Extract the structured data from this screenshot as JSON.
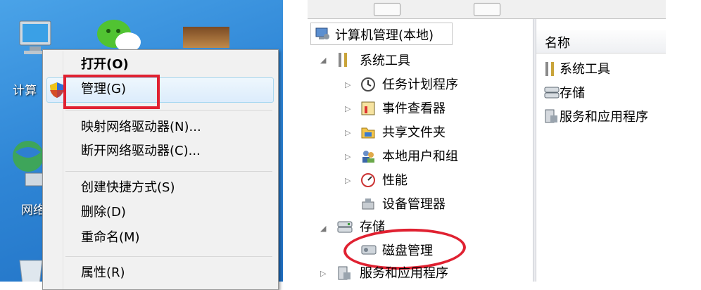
{
  "context_menu": {
    "open": "打开(O)",
    "manage": "管理(G)",
    "map_drive": "映射网络驱动器(N)...",
    "disconnect_drive": "断开网络驱动器(C)...",
    "create_shortcut": "创建快捷方式(S)",
    "delete": "删除(D)",
    "rename": "重命名(M)",
    "properties": "属性(R)"
  },
  "desktop": {
    "computer_label": "计算",
    "network_label": "网络"
  },
  "tree": {
    "root": "计算机管理(本地)",
    "system_tools": "系统工具",
    "task_scheduler": "任务计划程序",
    "event_viewer": "事件查看器",
    "shared_folders": "共享文件夹",
    "local_users": "本地用户和组",
    "performance": "性能",
    "device_manager": "设备管理器",
    "storage": "存储",
    "disk_management": "磁盘管理",
    "services_apps": "服务和应用程序"
  },
  "list": {
    "header_name": "名称",
    "items": [
      "系统工具",
      "存储",
      "服务和应用程序"
    ]
  },
  "colors": {
    "annotation_red": "#e02131",
    "desktop_blue": "#2f86d6"
  }
}
